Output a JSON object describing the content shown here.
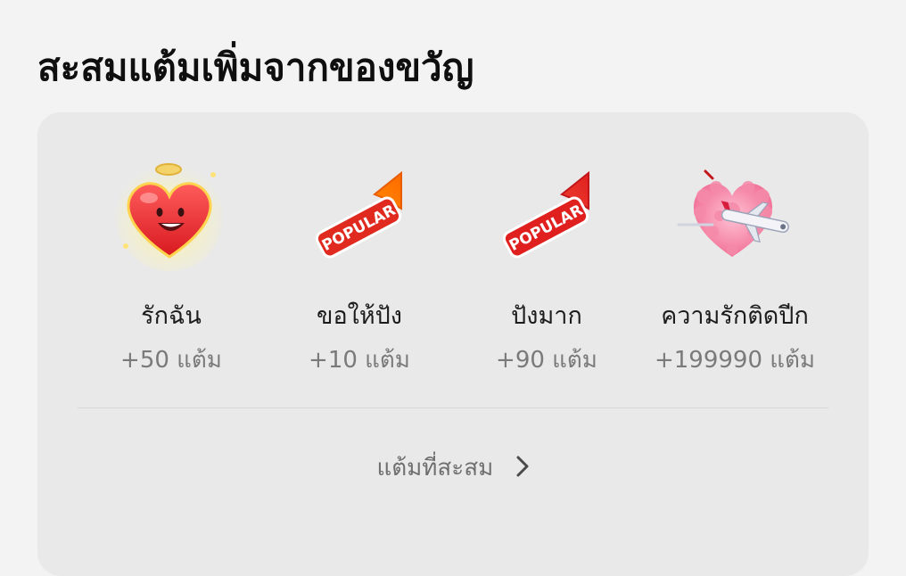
{
  "page_title": "สะสมแต้มเพิ่มจากของขวัญ",
  "gifts": [
    {
      "name": "รักฉัน",
      "points": "+50 แต้ม",
      "icon": "smiling-heart-icon"
    },
    {
      "name": "ขอให้ปัง",
      "points": "+10 แต้ม",
      "icon": "popular-arrow-icon",
      "icon_text": "POPULAR"
    },
    {
      "name": "ปังมาก",
      "points": "+90 แต้ม",
      "icon": "popular-arrow-icon",
      "icon_text": "POPULAR"
    },
    {
      "name": "ความรักติดปีก",
      "points": "+199990 แต้ม",
      "icon": "fluffy-heart-airplane-icon"
    }
  ],
  "footer": {
    "link_label": "แต้มที่สะสม",
    "chevron_icon": "chevron-right-icon"
  }
}
